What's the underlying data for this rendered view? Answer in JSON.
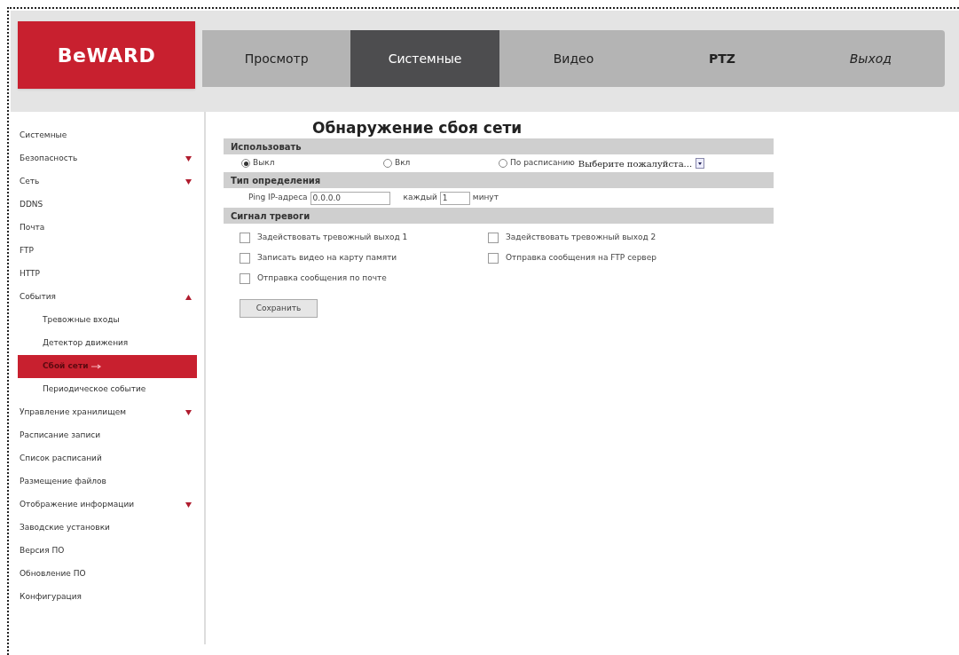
{
  "logo": {
    "text": "BeWARD"
  },
  "nav": [
    {
      "label": "Просмотр",
      "selected": false,
      "kind": "normal"
    },
    {
      "label": "Системные",
      "selected": true,
      "kind": "normal"
    },
    {
      "label": "Видео",
      "selected": false,
      "kind": "normal"
    },
    {
      "label": "PTZ",
      "selected": false,
      "kind": "bold"
    },
    {
      "label": "Выход",
      "selected": false,
      "kind": "italic"
    }
  ],
  "sidebar": {
    "items": [
      {
        "label": "Системные"
      },
      {
        "label": "Безопасность",
        "expanded": false
      },
      {
        "label": "Сеть",
        "expanded": false
      },
      {
        "label": "DDNS"
      },
      {
        "label": "Почта"
      },
      {
        "label": "FTP"
      },
      {
        "label": "HTTP"
      },
      {
        "label": "События",
        "expanded": true,
        "children": [
          {
            "label": "Тревожные входы",
            "selected": false
          },
          {
            "label": "Детектор движения",
            "selected": false
          },
          {
            "label": "Сбой сети",
            "selected": true
          },
          {
            "label": "Периодическое событие",
            "selected": false
          }
        ]
      },
      {
        "label": "Управление хранилищем",
        "expanded": false
      },
      {
        "label": "Расписание записи"
      },
      {
        "label": "Список расписаний"
      },
      {
        "label": "Размещение файлов"
      },
      {
        "label": "Отображение информации",
        "expanded": false
      },
      {
        "label": "Заводские установки"
      },
      {
        "label": "Версия ПО"
      },
      {
        "label": "Обновление ПО"
      },
      {
        "label": "Конфигурация"
      }
    ]
  },
  "page": {
    "title": "Обнаружение сбоя сети",
    "use": {
      "heading": "Использовать",
      "options": [
        {
          "label": "Выкл",
          "selected": true
        },
        {
          "label": "Вкл",
          "selected": false
        },
        {
          "label": "По расписанию",
          "selected": false
        }
      ],
      "schedule_select": "Выберите пожалуйста..."
    },
    "detect": {
      "heading": "Тип определения",
      "ping_label": "Ping IP-адреса",
      "ip": "0.0.0.0",
      "every_label": "каждый",
      "minutes": "1",
      "unit": "минут"
    },
    "alarm": {
      "heading": "Сигнал тревоги",
      "checks": [
        {
          "label": "Задействовать тревожный выход 1",
          "checked": false
        },
        {
          "label": "Задействовать тревожный выход 2",
          "checked": false
        },
        {
          "label": "Записать видео на карту памяти",
          "checked": false
        },
        {
          "label": "Отправка сообщения на FTP сервер",
          "checked": false
        },
        {
          "label": "Отправка сообщения по почте",
          "checked": false
        }
      ]
    },
    "save": "Сохранить"
  }
}
